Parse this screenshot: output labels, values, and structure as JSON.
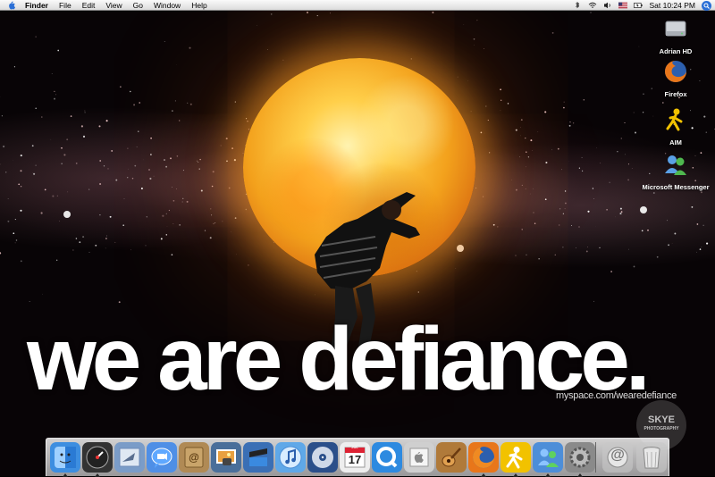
{
  "menubar": {
    "apple_icon": "apple-icon",
    "items": [
      "Finder",
      "File",
      "Edit",
      "View",
      "Go",
      "Window",
      "Help"
    ],
    "clock": "Sat 10:24 PM",
    "status_icons": [
      "bluetooth-icon",
      "wifi-icon",
      "volume-icon",
      "flag-icon",
      "battery-icon",
      "spotlight-icon"
    ]
  },
  "wallpaper": {
    "headline": "we are defiance.",
    "tagline": "myspace.com/wearedefiance",
    "watermark": "SKYE",
    "watermark_small": "PHOTOGRAPHY"
  },
  "desktop_icons": [
    {
      "label": "Adrian HD",
      "icon": "hard-drive-icon"
    },
    {
      "label": "Firefox",
      "icon": "firefox-icon"
    },
    {
      "label": "AIM",
      "icon": "aim-icon"
    },
    {
      "label": "Microsoft Messenger",
      "icon": "messenger-icon"
    }
  ],
  "dock": {
    "items": [
      {
        "name": "finder",
        "icon": "finder-icon",
        "color": "#3d8ee0",
        "running": true
      },
      {
        "name": "dashboard",
        "icon": "dashboard-icon",
        "color": "#333333",
        "running": true
      },
      {
        "name": "mail",
        "icon": "mail-icon",
        "color": "#7a9cc8",
        "running": false
      },
      {
        "name": "ichat",
        "icon": "ichat-icon",
        "color": "#4f8fe6",
        "running": false
      },
      {
        "name": "address-book",
        "icon": "address-book-icon",
        "color": "#b08a55",
        "running": false
      },
      {
        "name": "iphoto",
        "icon": "iphoto-icon",
        "color": "#4a6f9a",
        "running": false
      },
      {
        "name": "imovie",
        "icon": "imovie-icon",
        "color": "#3a6fb5",
        "running": false
      },
      {
        "name": "itunes",
        "icon": "itunes-icon",
        "color": "#5fa8e8",
        "running": false
      },
      {
        "name": "dvd-player",
        "icon": "dvd-player-icon",
        "color": "#2b4f8a",
        "running": false
      },
      {
        "name": "ical",
        "icon": "ical-icon",
        "color": "#eeeeee",
        "running": false
      },
      {
        "name": "quicktime",
        "icon": "quicktime-icon",
        "color": "#2d8ae0",
        "running": false
      },
      {
        "name": "preview",
        "icon": "preview-icon",
        "color": "#cfcfcf",
        "running": false
      },
      {
        "name": "garageband",
        "icon": "garageband-icon",
        "color": "#b07a3a",
        "running": false
      },
      {
        "name": "firefox",
        "icon": "firefox-icon",
        "color": "#e8761a",
        "running": true
      },
      {
        "name": "aim",
        "icon": "aim-icon",
        "color": "#f2c200",
        "running": true
      },
      {
        "name": "messenger",
        "icon": "messenger-icon",
        "color": "#4d8ed8",
        "running": true
      },
      {
        "name": "system-preferences",
        "icon": "system-preferences-icon",
        "color": "#8a8a8a",
        "running": true
      }
    ],
    "right_items": [
      {
        "name": "downloads-stack",
        "icon": "at-sign-icon",
        "label": "@"
      },
      {
        "name": "trash",
        "icon": "trash-icon"
      }
    ],
    "ical_date": "17",
    "ical_month": "JUL"
  }
}
